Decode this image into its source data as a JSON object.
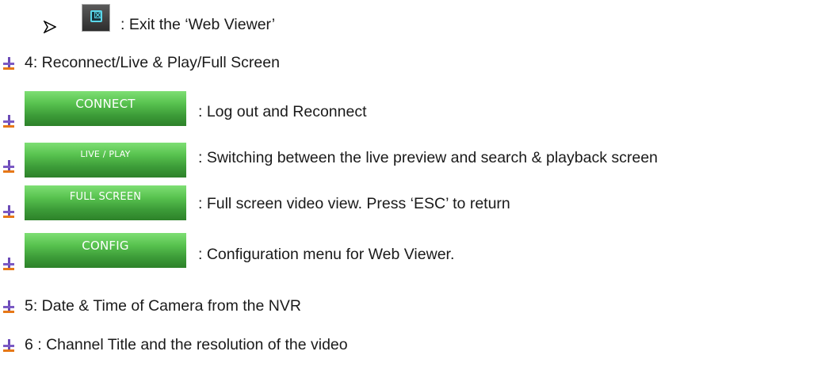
{
  "exit": {
    "icon": "close-box-icon",
    "text": ": Exit the ‘Web Viewer’"
  },
  "items": [
    {
      "text": "4: Reconnect/Live & Play/Full Screen"
    },
    {
      "button_label": "CONNECT",
      "text": ": Log out and Reconnect"
    },
    {
      "button_label": "LIVE / PLAY",
      "text": ": Switching between the live preview and search & playback screen"
    },
    {
      "button_label": "FULL SCREEN",
      "text": ": Full screen video view. Press ‘ESC’ to return"
    },
    {
      "button_label": "CONFIG",
      "text": ": Configuration menu for Web Viewer."
    },
    {
      "text": "5: Date & Time of Camera from the NVR"
    },
    {
      "text": "6 : Channel Title and the resolution of the video"
    }
  ],
  "colors": {
    "button_green": "#4fb346",
    "bullet_purple": "#6c4bb7",
    "bullet_orange": "#e67817",
    "icon_cyan": "#5ad7ea"
  }
}
